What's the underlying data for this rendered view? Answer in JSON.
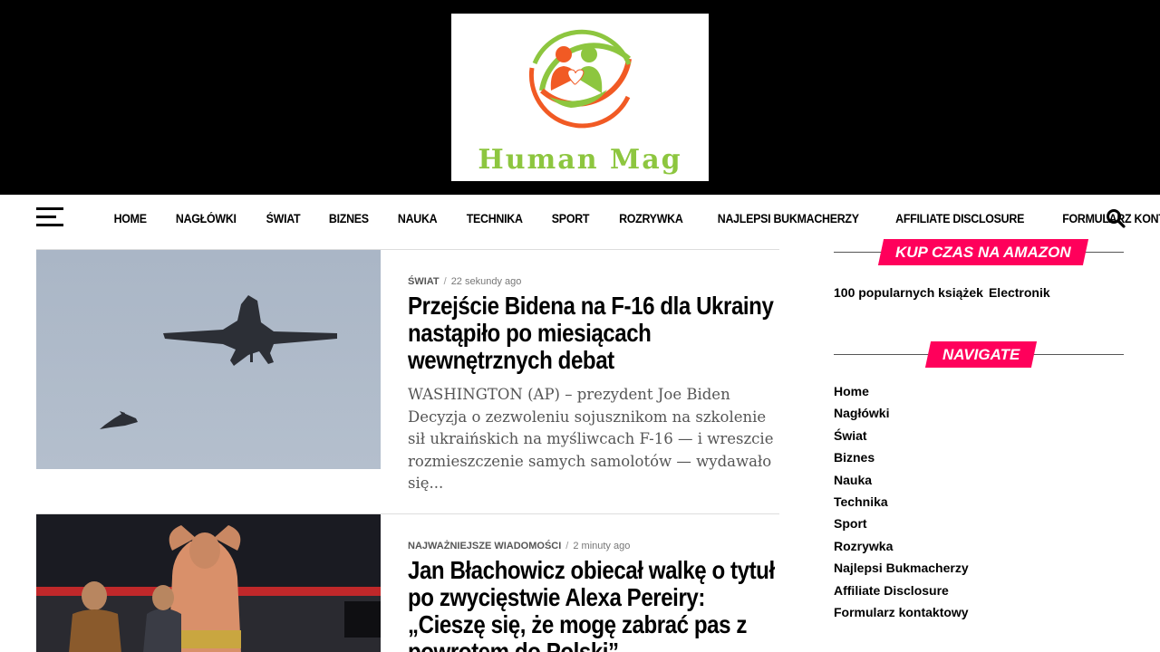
{
  "logo": {
    "text": "Human Mag",
    "colors": {
      "green": "#8dc63f",
      "orange": "#f15a24"
    }
  },
  "nav": {
    "items": [
      "HOME",
      "NAGŁÓWKI",
      "ŚWIAT",
      "BIZNES",
      "NAUKA",
      "TECHNIKA",
      "SPORT",
      "ROZRYWKA",
      "NAJLEPSI BUKMACHERZY",
      "AFFILIATE DISCLOSURE",
      "FORMULARZ KONTAKTOWY"
    ]
  },
  "articles": [
    {
      "category": "ŚWIAT",
      "separator": "/",
      "time": "22 sekundy ago",
      "title": "Przejście Bidena na F-16 dla Ukrainy nastąpiło po miesiącach wewnętrznych debat",
      "excerpt": "WASHINGTON (AP) – prezydent Joe Biden Decyzja o zezwoleniu sojusznikom na szkolenie sił ukraińskich na myśliwcach F-16 — i wreszcie rozmieszczenie samych samolotów — wydawało się..."
    },
    {
      "category": "NAJWAŻNIEJSZE WIADOMOŚCI",
      "separator": "/",
      "time": "2 minuty ago",
      "title": "Jan Błachowicz obiecał walkę o tytuł po zwycięstwie Alexa Pereiry: „Cieszę się, że mogę zabrać pas z powrotem do Polski”",
      "excerpt": ""
    }
  ],
  "sidebar": {
    "amazon_widget": {
      "title": "KUP CZAS NA AMAZON",
      "links": [
        "100 popularnych książek",
        "Electronik"
      ]
    },
    "navigate_widget": {
      "title": "NAVIGATE",
      "links": [
        "Home",
        "Nagłówki",
        "Świat",
        "Biznes",
        "Nauka",
        "Technika",
        "Sport",
        "Rozrywka",
        "Najlepsi Bukmacherzy",
        "Affiliate Disclosure",
        "Formularz kontaktowy"
      ]
    },
    "accent_color": "#ff005b"
  }
}
